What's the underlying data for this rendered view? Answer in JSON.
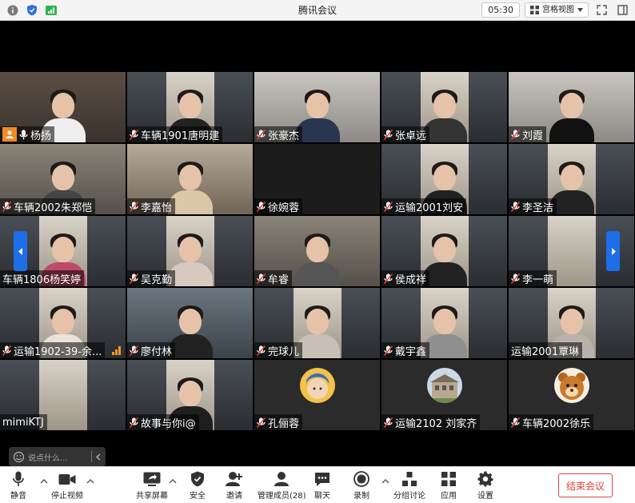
{
  "window": {
    "title": "腾讯会议",
    "timer": "05:30",
    "view_mode": "宫格视图"
  },
  "participants": [
    {
      "name": "杨扬",
      "host": true
    },
    {
      "name": "车辆1901唐明建"
    },
    {
      "name": "张豪杰"
    },
    {
      "name": "张卓远"
    },
    {
      "name": "刘霞"
    },
    {
      "name": "车辆2002朱郑恺"
    },
    {
      "name": "李嘉怡"
    },
    {
      "name": "徐婉蓉"
    },
    {
      "name": "运输2001刘安"
    },
    {
      "name": "李圣洁"
    },
    {
      "name": "车辆1806杨笑婷"
    },
    {
      "name": "吴克勤"
    },
    {
      "name": "牟睿"
    },
    {
      "name": "侯成祥"
    },
    {
      "name": "李一萌"
    },
    {
      "name": "运输1902-39-余..."
    },
    {
      "name": "廖付林"
    },
    {
      "name": "完球儿"
    },
    {
      "name": "戴宇鑫"
    },
    {
      "name": "运输2001覃琳"
    },
    {
      "name": "mimiKTJ"
    },
    {
      "name": "故事与你i@"
    },
    {
      "name": "孔俪蓉"
    },
    {
      "name": "运输2102 刘家齐"
    },
    {
      "name": "车辆2002徐乐"
    }
  ],
  "chat_popup": {
    "placeholder": "说点什么..."
  },
  "toolbar": {
    "mute": "静音",
    "stop_video": "停止视频",
    "share_screen": "共享屏幕",
    "security": "安全",
    "invite": "邀请",
    "manage_members": "管理成员(28)",
    "chat": "聊天",
    "record": "录制",
    "breakout": "分组讨论",
    "apps": "应用",
    "settings": "设置",
    "end_meeting": "结束会议"
  },
  "colors": {
    "accent_blue": "#1e6ee8",
    "end_red": "#e2413b",
    "host_orange": "#f08a24",
    "signal_green": "#2bb24c"
  }
}
